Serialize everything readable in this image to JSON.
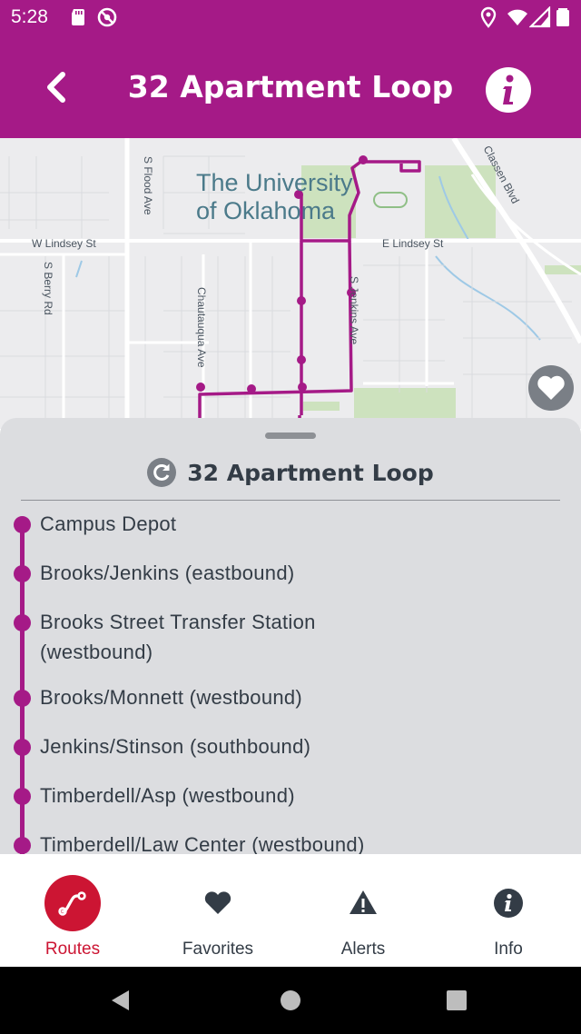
{
  "status_bar": {
    "time": "5:28",
    "left_icons": [
      "sd-card-icon",
      "no-disturb-icon"
    ],
    "right_icons": [
      "location-icon",
      "wifi-icon",
      "cell-signal-icon",
      "battery-icon"
    ]
  },
  "header": {
    "title": "32 Apartment Loop",
    "back_icon": "back-arrow-icon",
    "info_icon": "info-icon",
    "background": "#a51a87"
  },
  "map": {
    "campus_line1": "The University",
    "campus_line2": "of Oklahoma",
    "streets": {
      "s_flood_ave": "S Flood Ave",
      "classen_blvd": "Classen Blvd",
      "w_lindsey_st": "W Lindsey St",
      "e_lindsey_st": "E Lindsey St",
      "s_berry_rd": "S Berry Rd",
      "chautauqua_ave": "Chautauqua Ave",
      "s_jenkins_ave": "S Jenkins Ave"
    },
    "route_color": "#a51a87",
    "favorite_icon": "heart-icon"
  },
  "sheet": {
    "route_icon": "loop-arrow-icon",
    "route_name": "32 Apartment Loop",
    "stops": [
      {
        "line1": "Campus Depot",
        "line2": ""
      },
      {
        "line1": "Brooks/Jenkins (eastbound)",
        "line2": ""
      },
      {
        "line1": "Brooks Street Transfer Station",
        "line2": "(westbound)"
      },
      {
        "line1": "Brooks/Monnett (westbound)",
        "line2": ""
      },
      {
        "line1": "Jenkins/Stinson (southbound)",
        "line2": ""
      },
      {
        "line1": "Timberdell/Asp (westbound)",
        "line2": ""
      },
      {
        "line1": "Timberdell/Law Center (westbound)",
        "line2": ""
      }
    ]
  },
  "bottom_nav": {
    "active_color": "#cc1533",
    "items": [
      {
        "label": "Routes",
        "icon": "route-path-icon",
        "active": true
      },
      {
        "label": "Favorites",
        "icon": "heart-icon",
        "active": false
      },
      {
        "label": "Alerts",
        "icon": "warning-icon",
        "active": false
      },
      {
        "label": "Info",
        "icon": "info-icon",
        "active": false
      }
    ]
  },
  "system_nav": {
    "icons": [
      "back-triangle-icon",
      "home-circle-icon",
      "recents-square-icon"
    ]
  }
}
